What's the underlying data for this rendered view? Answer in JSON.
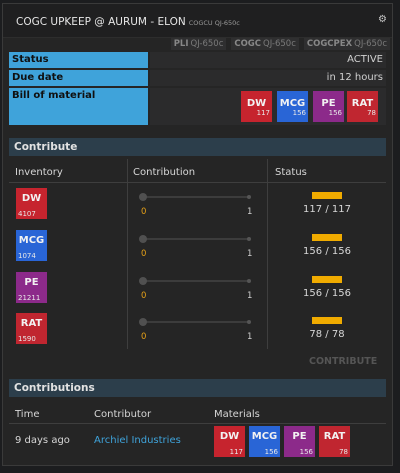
{
  "window": {
    "title": "COGC UPKEEP @ AURUM - ELON",
    "subtitle": "COGCU QJ-650c",
    "tickers": [
      {
        "code": "PLI",
        "target": "QJ-650c"
      },
      {
        "code": "COGC",
        "target": "QJ-650c"
      },
      {
        "code": "COGCPEX",
        "target": "QJ-650c"
      }
    ]
  },
  "details": {
    "status_label": "Status",
    "status_value": "ACTIVE",
    "due_label": "Due date",
    "due_value": "in 12 hours",
    "bom_label": "Bill of material",
    "bom": [
      {
        "ticker": "DW",
        "amount": "117",
        "color": "#c6242e"
      },
      {
        "ticker": "MCG",
        "amount": "156",
        "color": "#2965d6"
      },
      {
        "ticker": "PE",
        "amount": "156",
        "color": "#8c2a8a"
      },
      {
        "ticker": "RAT",
        "amount": "78",
        "color": "#c02630"
      }
    ]
  },
  "contribute": {
    "section_title": "Contribute",
    "col_inventory": "Inventory",
    "col_contribution": "Contribution",
    "col_status": "Status",
    "rows": [
      {
        "ticker": "DW",
        "inventory": "4107",
        "min": "0",
        "max": "1",
        "status": "117 / 117",
        "progress": 1.0
      },
      {
        "ticker": "MCG",
        "inventory": "1074",
        "min": "0",
        "max": "1",
        "status": "156 / 156",
        "progress": 1.0
      },
      {
        "ticker": "PE",
        "inventory": "21211",
        "min": "0",
        "max": "1",
        "status": "156 / 156",
        "progress": 1.0
      },
      {
        "ticker": "RAT",
        "inventory": "1590",
        "min": "0",
        "max": "1",
        "status": "78 / 78",
        "progress": 1.0
      }
    ],
    "button_label": "CONTRIBUTE"
  },
  "contributions": {
    "section_title": "Contributions",
    "col_time": "Time",
    "col_contributor": "Contributor",
    "col_materials": "Materials",
    "rows": [
      {
        "time": "9 days ago",
        "contributor": "Archiel Industries",
        "materials": [
          {
            "ticker": "DW",
            "amount": "117"
          },
          {
            "ticker": "MCG",
            "amount": "156"
          },
          {
            "ticker": "PE",
            "amount": "156"
          },
          {
            "ticker": "RAT",
            "amount": "78"
          }
        ]
      }
    ]
  },
  "icons": {
    "settings": "gear-icon"
  },
  "colors": {
    "accent": "#3fa3da",
    "progress": "#f0ab00"
  }
}
